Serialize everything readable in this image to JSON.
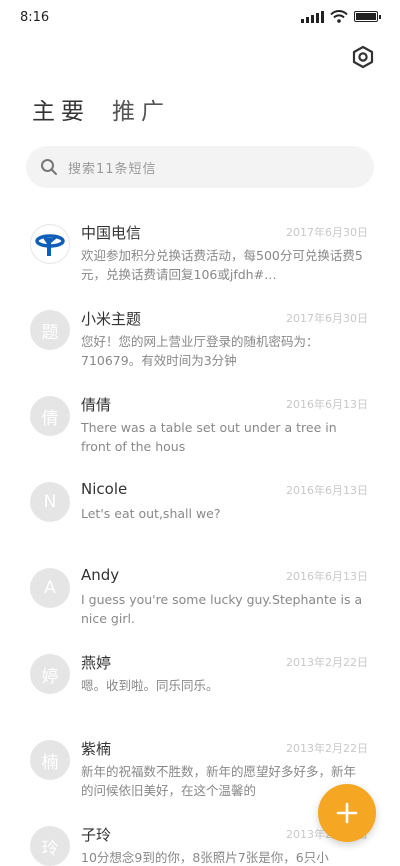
{
  "status_bar": {
    "time": "8:16",
    "battery_level": 1.0
  },
  "header": {
    "tabs": [
      {
        "label": "主要",
        "active": true
      },
      {
        "label": "推广",
        "active": false
      }
    ],
    "settings_icon": "hexagon-settings-icon"
  },
  "search": {
    "placeholder": "搜索11条短信"
  },
  "conversations": [
    {
      "name": "中国电信",
      "date": "2017年6月30日",
      "preview": "欢迎参加积分兑换话费活动，每500分可兑换话费5元，兑换话费请回复106或jfdh#…",
      "avatar_text": "",
      "avatar_icon": "china-telecom-logo"
    },
    {
      "name": "小米主题",
      "date": "2017年6月30日",
      "preview": "您好！您的网上营业厅登录的随机密码为：710679。有效时间为3分钟",
      "avatar_text": "题"
    },
    {
      "name": "倩倩",
      "date": "2016年6月13日",
      "preview": "There was a table set out under a tree in front of the hous",
      "avatar_text": "倩"
    },
    {
      "name": "Nicole",
      "date": "2016年6月13日",
      "preview": "Let's eat out,shall we?",
      "avatar_text": "N"
    },
    {
      "name": "Andy",
      "date": "2016年6月13日",
      "preview": "I guess you're some lucky guy.Stephante is a nice girl.",
      "avatar_text": "A"
    },
    {
      "name": "燕婷",
      "date": "2013年2月22日",
      "preview": "嗯。收到啦。同乐同乐。",
      "avatar_text": "婷"
    },
    {
      "name": "紫楠",
      "date": "2013年2月22日",
      "preview": "新年的祝福数不胜数，新年的愿望好多好多，新年的问候依旧美好，在这个温馨的",
      "avatar_text": "楠"
    },
    {
      "name": "子玲",
      "date": "2013年2月22日",
      "preview": "10分想念9到的你，8张照片7张是你，6只小",
      "avatar_text": "玲"
    }
  ],
  "fab": {
    "icon": "plus-icon"
  },
  "colors": {
    "accent": "#f5a623",
    "avatar_bg": "#e5e5e5",
    "brand_blue": "#0f5fb8"
  }
}
